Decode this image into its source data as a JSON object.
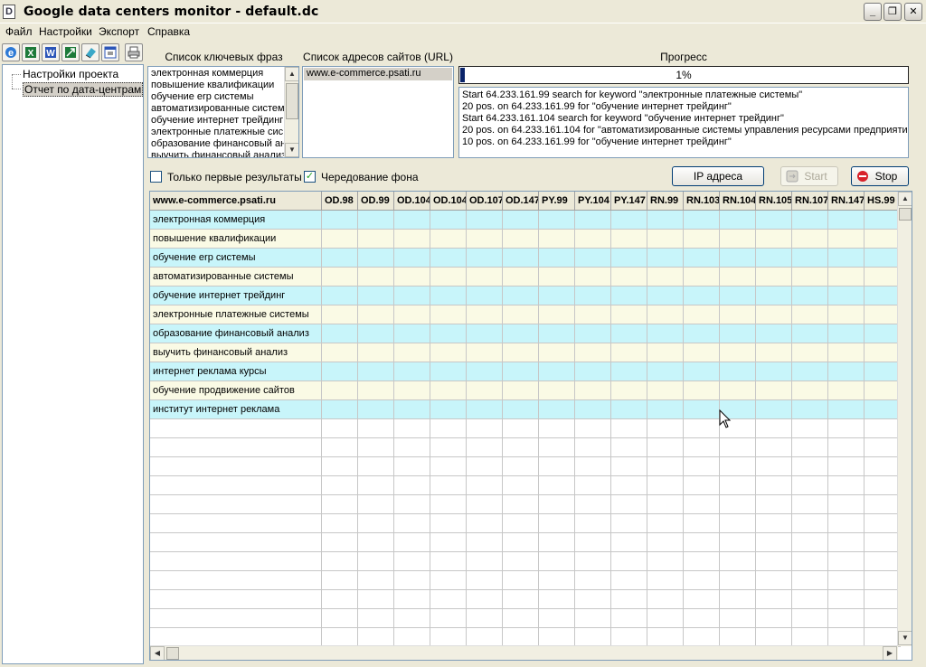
{
  "window": {
    "title": "Google data centers monitor - default.dc",
    "app_icon": "D",
    "minimize_glyph": "_",
    "maximize_glyph": "❐",
    "close_glyph": "✕"
  },
  "menu": [
    "Файл",
    "Настройки",
    "Экспорт",
    "Справка"
  ],
  "toolbar_icons": [
    "ie-icon",
    "excel-icon",
    "word-icon",
    "excel-export-icon",
    "eraser-icon",
    "html-icon",
    "print-icon"
  ],
  "tree": {
    "items": [
      "Настройки проекта",
      "Отчет по дата-центрам"
    ]
  },
  "keywords_panel": {
    "label": "Список ключевых фраз",
    "items": [
      "электронная коммерция",
      "повышение квалификации",
      "обучение erp системы",
      "автоматизированные систем",
      "обучение интернет трейдинг",
      "электронные платежные сис",
      "образование финансовый ан",
      "выучить финансовый анализ"
    ]
  },
  "urls_panel": {
    "label": "Список адресов сайтов (URL)",
    "items": [
      "www.e-commerce.psati.ru"
    ]
  },
  "progress": {
    "label": "Прогресс",
    "value": 0.01,
    "text": "1%"
  },
  "log": [
    "Start 64.233.161.99 search for keyword \"электронные платежные системы\"",
    "20 pos. on 64.233.161.99 for \"обучение интернет трейдинг\"",
    "Start 64.233.161.104 search for keyword \"обучение интернет трейдинг\"",
    "20 pos. on 64.233.161.104 for \"автоматизированные системы управления ресурсами предприяти",
    "10 pos. on 64.233.161.99 for \"обучение интернет трейдинг\""
  ],
  "options": {
    "first_results_label": "Только первые результаты",
    "first_results_checked": false,
    "alt_bg_label": "Чередование фона",
    "alt_bg_checked": true,
    "check_glyph": "✓"
  },
  "buttons": {
    "ip": "IP адреса",
    "start": "Start",
    "stop": "Stop"
  },
  "grid": {
    "columns": [
      "www.e-commerce.psati.ru",
      "OD.98",
      "OD.99",
      "OD.104",
      "OD.104",
      "OD.107",
      "OD.147",
      "PY.99",
      "PY.104",
      "PY.147",
      "RN.99",
      "RN.103",
      "RN.104",
      "RN.105",
      "RN.107",
      "RN.147",
      "HS.99"
    ],
    "rows": [
      "электронная коммерция",
      "повышение квалификации",
      "обучение erp системы",
      "автоматизированные системы",
      "обучение интернет трейдинг",
      "электронные платежные системы",
      "образование финансовый анализ",
      "выучить финансовый анализ",
      "интернет реклама курсы",
      "обучение продвижение сайтов",
      "институт интернет реклама"
    ],
    "row_colors": [
      "#c8f5fa",
      "#fafae5"
    ]
  }
}
